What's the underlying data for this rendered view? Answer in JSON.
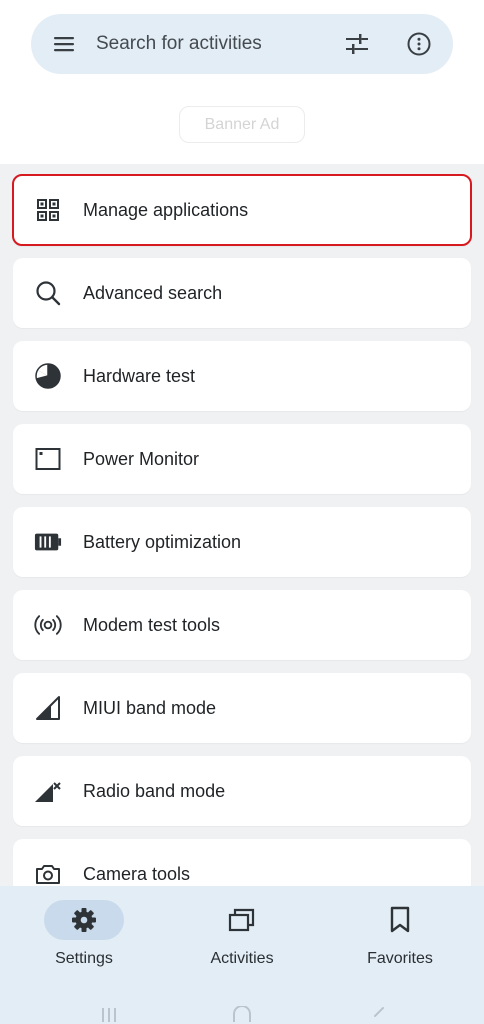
{
  "search": {
    "placeholder": "Search for activities",
    "menu_icon": "menu-icon",
    "filter_icon": "tune-icon",
    "info_icon": "info-icon"
  },
  "banner": {
    "label": "Banner Ad"
  },
  "list": {
    "items": [
      {
        "label": "Manage applications",
        "icon": "apps-grid-icon",
        "highlighted": true
      },
      {
        "label": "Advanced search",
        "icon": "search-icon"
      },
      {
        "label": "Hardware test",
        "icon": "pie-chart-icon"
      },
      {
        "label": "Power Monitor",
        "icon": "window-icon"
      },
      {
        "label": "Battery optimization",
        "icon": "battery-icon"
      },
      {
        "label": "Modem test tools",
        "icon": "radio-signal-icon"
      },
      {
        "label": "MIUI band mode",
        "icon": "signal-cellular-icon"
      },
      {
        "label": "Radio band mode",
        "icon": "signal-cellular-off-icon"
      },
      {
        "label": "Camera tools",
        "icon": "camera-icon"
      }
    ]
  },
  "nav": {
    "settings": {
      "label": "Settings",
      "icon": "gear-icon",
      "active": true
    },
    "activities": {
      "label": "Activities",
      "icon": "stacked-windows-icon"
    },
    "favorites": {
      "label": "Favorites",
      "icon": "bookmark-icon"
    }
  },
  "system_nav": {
    "recent_icon": "recent-apps-icon",
    "home_icon": "home-icon",
    "back_icon": "back-icon"
  },
  "colors": {
    "accent_surface": "#e3edf5",
    "active_pill": "#c8daeb",
    "list_background": "#f0f1f3",
    "highlight_border": "#d61a20",
    "text_primary": "#1f2326"
  }
}
